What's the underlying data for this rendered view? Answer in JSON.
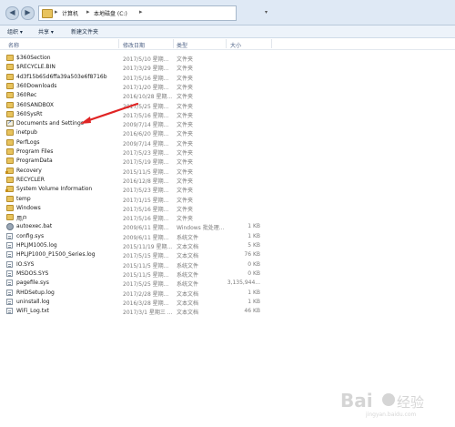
{
  "address": {
    "back_symbol": "◀",
    "forward_symbol": "▶",
    "crumbs": [
      "计算机",
      "本地磁盘 (C:)"
    ],
    "separator": "▸",
    "dropdown": "▾"
  },
  "toolbar": {
    "organize": "组织 ▾",
    "share": "共享 ▾",
    "new_folder": "新建文件夹"
  },
  "columns": {
    "name": "名称",
    "modified": "修改日期",
    "type": "类型",
    "size": "大小"
  },
  "files": [
    {
      "name": "$360Section",
      "date": "2017/5/10 星期...",
      "type": "文件夹",
      "size": "",
      "icon": "folder"
    },
    {
      "name": "$RECYCLE.BIN",
      "date": "2017/3/29 星期...",
      "type": "文件夹",
      "size": "",
      "icon": "folder"
    },
    {
      "name": "4d3f15b65d6ffa39a503e6f8716b",
      "date": "2017/5/16 星期...",
      "type": "文件夹",
      "size": "",
      "icon": "folder"
    },
    {
      "name": "360Downloads",
      "date": "2017/1/20 星期...",
      "type": "文件夹",
      "size": "",
      "icon": "folder"
    },
    {
      "name": "360Rec",
      "date": "2016/10/28 星期...",
      "type": "文件夹",
      "size": "",
      "icon": "folder"
    },
    {
      "name": "360SANDBOX",
      "date": "2017/5/25 星期...",
      "type": "文件夹",
      "size": "",
      "icon": "folder"
    },
    {
      "name": "360SysRt",
      "date": "2017/5/16 星期...",
      "type": "文件夹",
      "size": "",
      "icon": "folder"
    },
    {
      "name": "Documents and Settings",
      "date": "2009/7/14 星期...",
      "type": "文件夹",
      "size": "",
      "icon": "shortcut"
    },
    {
      "name": "inetpub",
      "date": "2016/6/20 星期...",
      "type": "文件夹",
      "size": "",
      "icon": "folder"
    },
    {
      "name": "PerfLogs",
      "date": "2009/7/14 星期...",
      "type": "文件夹",
      "size": "",
      "icon": "folder"
    },
    {
      "name": "Program Files",
      "date": "2017/5/23 星期...",
      "type": "文件夹",
      "size": "",
      "icon": "folder"
    },
    {
      "name": "ProgramData",
      "date": "2017/5/19 星期...",
      "type": "文件夹",
      "size": "",
      "icon": "folder"
    },
    {
      "name": "Recovery",
      "date": "2015/11/5 星期...",
      "type": "文件夹",
      "size": "",
      "icon": "folder-lock"
    },
    {
      "name": "RECYCLER",
      "date": "2016/12/8 星期...",
      "type": "文件夹",
      "size": "",
      "icon": "folder"
    },
    {
      "name": "System Volume Information",
      "date": "2017/5/23 星期...",
      "type": "文件夹",
      "size": "",
      "icon": "folder-lock"
    },
    {
      "name": "temp",
      "date": "2017/1/15 星期...",
      "type": "文件夹",
      "size": "",
      "icon": "folder"
    },
    {
      "name": "Windows",
      "date": "2017/5/16 星期...",
      "type": "文件夹",
      "size": "",
      "icon": "folder"
    },
    {
      "name": "用户",
      "date": "2017/5/16 星期...",
      "type": "文件夹",
      "size": "",
      "icon": "folder"
    },
    {
      "name": "autoexec.bat",
      "date": "2009/6/11 星期...",
      "type": "Windows 批处理...",
      "size": "1 KB",
      "icon": "gear"
    },
    {
      "name": "config.sys",
      "date": "2009/6/11 星期...",
      "type": "系统文件",
      "size": "1 KB",
      "icon": "file"
    },
    {
      "name": "HPLJM1005.log",
      "date": "2015/11/19 星期...",
      "type": "文本文档",
      "size": "5 KB",
      "icon": "file"
    },
    {
      "name": "HPLJP1000_P1500_Series.log",
      "date": "2017/5/15 星期...",
      "type": "文本文档",
      "size": "76 KB",
      "icon": "file"
    },
    {
      "name": "IO.SYS",
      "date": "2015/11/5 星期...",
      "type": "系统文件",
      "size": "0 KB",
      "icon": "file"
    },
    {
      "name": "MSDOS.SYS",
      "date": "2015/11/5 星期...",
      "type": "系统文件",
      "size": "0 KB",
      "icon": "file"
    },
    {
      "name": "pagefile.sys",
      "date": "2017/5/25 星期...",
      "type": "系统文件",
      "size": "3,135,944...",
      "icon": "file"
    },
    {
      "name": "RHDSetup.log",
      "date": "2017/2/28 星期...",
      "type": "文本文档",
      "size": "1 KB",
      "icon": "file"
    },
    {
      "name": "uninstall.log",
      "date": "2016/3/28 星期...",
      "type": "文本文档",
      "size": "1 KB",
      "icon": "file"
    },
    {
      "name": "WiFi_Log.txt",
      "date": "2017/3/1 星期三 ...",
      "type": "文本文档",
      "size": "46 KB",
      "icon": "file"
    }
  ],
  "annotation_color": "#e02424",
  "watermark": {
    "brand": "Bai",
    "suffix": "经验",
    "domain": "jingyan.baidu.com"
  }
}
